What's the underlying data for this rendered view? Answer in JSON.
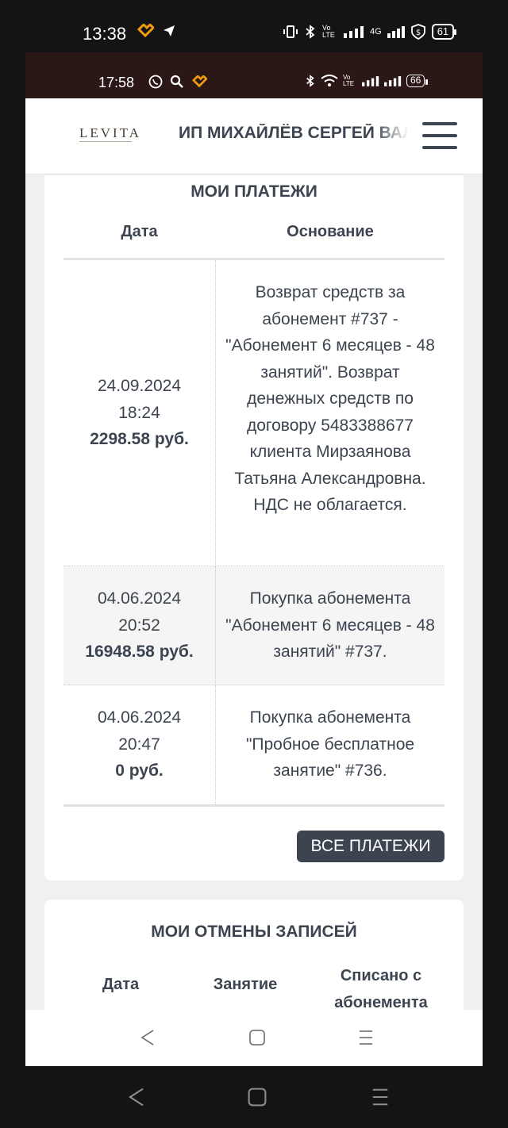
{
  "outer_status": {
    "time": "13:38",
    "battery": "61",
    "network": "4G",
    "volte": "Vo LTE"
  },
  "inner_status": {
    "time": "17:58",
    "battery": "66",
    "volte": "Vo LTE"
  },
  "header": {
    "logo": "LEVITA",
    "org_name": "ИП МИХАЙЛЁВ СЕРГЕЙ ВАЛЕРЬЕВИЧ"
  },
  "payments": {
    "title": "МОИ ПЛАТЕЖИ",
    "columns": [
      "Дата",
      "Основание"
    ],
    "rows": [
      {
        "date": "24.09.2024",
        "time": "18:24",
        "amount": "2298.58 руб.",
        "reason": "Возврат средств за абонемент #737 - \"Абонемент 6 месяцев - 48 занятий\". Возврат денежных средств по договору 5483388677 клиента Мирзаянова Татьяна Александровна. НДС не облагается."
      },
      {
        "date": "04.06.2024",
        "time": "20:52",
        "amount": "16948.58 руб.",
        "reason": "Покупка абонемента \"Абонемент 6 месяцев - 48 занятий\" #737."
      },
      {
        "date": "04.06.2024",
        "time": "20:47",
        "amount": "0 руб.",
        "reason": "Покупка абонемента \"Пробное бесплатное занятие\" #736."
      }
    ],
    "all_button": "ВСЕ ПЛАТЕЖИ"
  },
  "cancellations": {
    "title": "МОИ ОТМЕНЫ ЗАПИСЕЙ",
    "columns": [
      "Дата",
      "Занятие",
      "Списано с абонемента"
    ]
  },
  "icons": {
    "up": "arrow-up-icon",
    "back": "back-triangle-icon",
    "home": "home-square-icon",
    "menu": "menu-lines-icon"
  },
  "colors": {
    "text": "#3c4450",
    "button_bg": "#3c4450",
    "inner_status_bg": "#2b1716",
    "page_bg": "#f0f0f0"
  }
}
